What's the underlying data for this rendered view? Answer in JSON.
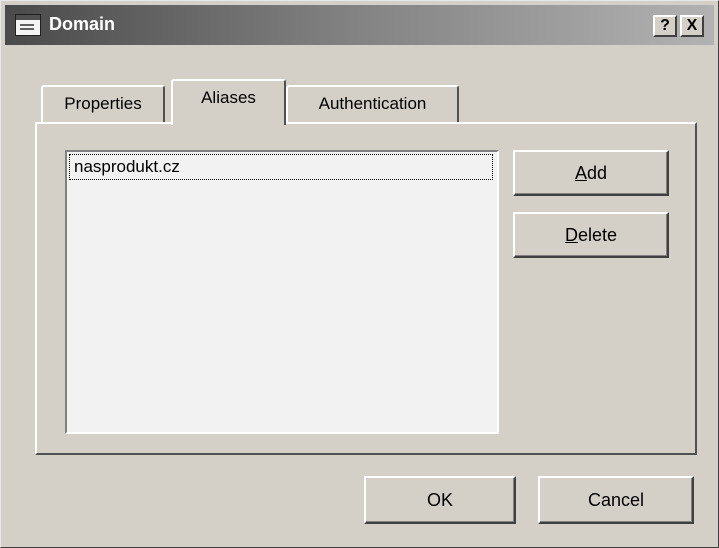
{
  "window": {
    "title": "Domain",
    "help_label": "?",
    "close_label": "X"
  },
  "tabs": [
    {
      "label": "Properties",
      "active": false
    },
    {
      "label": "Aliases",
      "active": true
    },
    {
      "label": "Authentication",
      "active": false
    }
  ],
  "aliases": {
    "items": [
      "nasprodukt.cz"
    ],
    "add": {
      "accel": "A",
      "rest": "dd"
    },
    "delete": {
      "accel": "D",
      "rest": "elete"
    }
  },
  "footer": {
    "ok_label": "OK",
    "cancel_label": "Cancel"
  },
  "icons": {
    "app": "window-app-icon",
    "help": "help-icon",
    "close": "close-icon"
  }
}
